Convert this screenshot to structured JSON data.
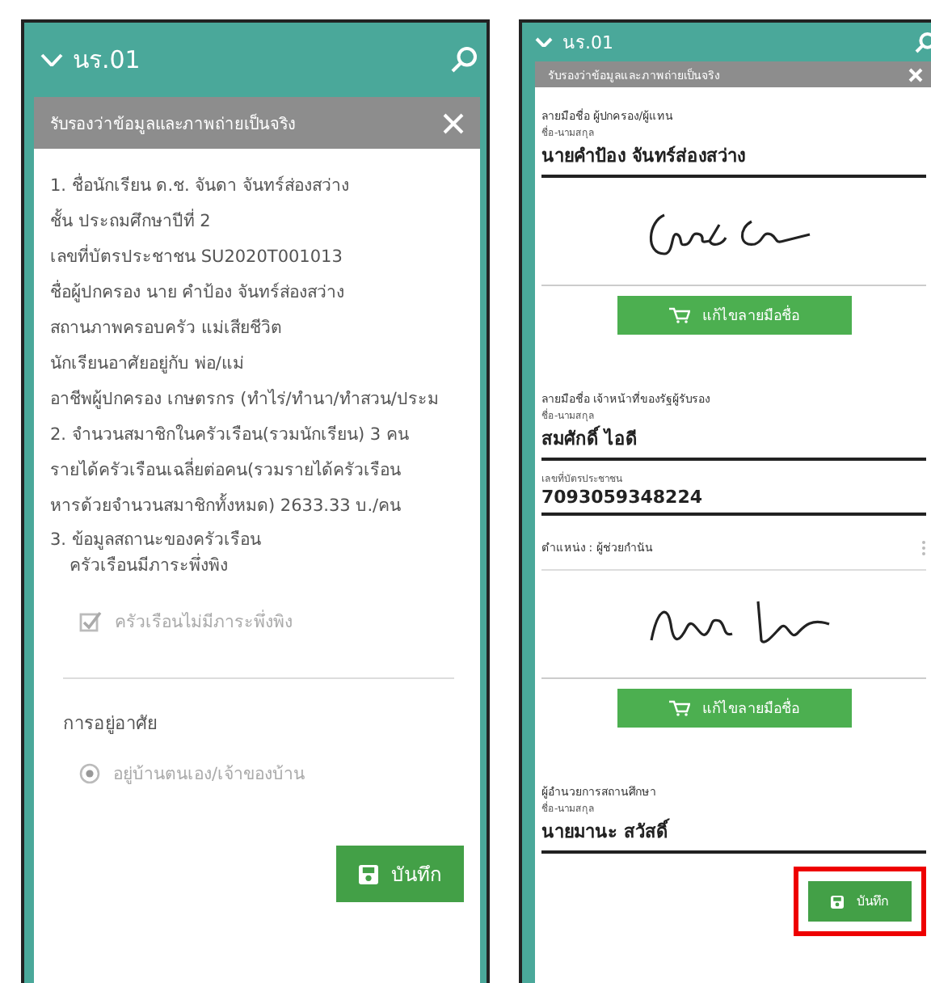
{
  "left_screen": {
    "header": {
      "title": "นร.01"
    },
    "dialog": {
      "title": "รับรองว่าข้อมูลและภาพถ่ายเป็นจริง",
      "items": [
        {
          "kind": "text",
          "text": "1. ชื่อนักเรียน  ด.ช. จันดา จันทร์ส่องสว่าง"
        },
        {
          "kind": "text",
          "text": "ชั้น  ประถมศึกษาปีที่ 2"
        },
        {
          "kind": "text",
          "text": "เลขที่บัตรประชาชน  SU2020T001013"
        },
        {
          "kind": "text",
          "text": "ชื่อผู้ปกครอง  นาย คำป้อง จันทร์ส่องสว่าง"
        },
        {
          "kind": "text",
          "text": "สถานภาพครอบครัว  แม่เสียชีวิต"
        },
        {
          "kind": "text",
          "text": "นักเรียนอาศัยอยู่กับ  พ่อ/แม่"
        },
        {
          "kind": "text",
          "text": "อาชีพผู้ปกครอง  เกษตรกร (ทำไร่/ทำนา/ทำสวน/ประม"
        },
        {
          "kind": "text",
          "text": "2. จำนวนสมาชิกในครัวเรือน(รวมนักเรียน)  3 คน"
        },
        {
          "kind": "text",
          "text": "รายได้ครัวเรือนเฉลี่ยต่อคน(รวมรายได้ครัวเรือน"
        },
        {
          "kind": "text",
          "text": "หารด้วยจำนวนสมาชิกทั้งหมด)  2633.33 บ./คน"
        },
        {
          "kind": "compact",
          "text": "3. ข้อมูลสถานะของครัวเรือน"
        },
        {
          "kind": "indented",
          "text": "ครัวเรือนมีภาระพึ่งพิง"
        },
        {
          "kind": "checkbox",
          "label": "ครัวเรือนไม่มีภาระพึ่งพิง",
          "checked": true
        },
        {
          "kind": "divider"
        },
        {
          "kind": "heading",
          "text": "การอยู่อาศัย"
        },
        {
          "kind": "radio",
          "label": "อยู่บ้านตนเอง/เจ้าของบ้าน",
          "selected": true
        }
      ],
      "save_button": {
        "label": "บันทึก"
      }
    }
  },
  "right_screen": {
    "header": {
      "title": "นร.01"
    },
    "dialog": {
      "title": "รับรองว่าข้อมูลและภาพถ่ายเป็นจริง",
      "signers": [
        {
          "label": "ลายมือชื่อ ผู้ปกครอง/ผู้แทน",
          "name_label": "ชื่อ-นามสกุล",
          "name": "นายคำป้อง จันทร์ส่องสว่าง",
          "signed": true,
          "edit_button": "แก้ไขลายมือชื่อ"
        },
        {
          "label": "ลายมือชื่อ เจ้าหน้าที่ของรัฐผู้รับรอง",
          "name_label": "ชื่อ-นามสกุล",
          "name": "สมศักดิ์ ไอดี",
          "id_label": "เลขที่บัตรประชาชน",
          "id": "7093059348224",
          "position": "ตำแหน่ง : ผู้ช่วยกำนัน",
          "signed": true,
          "edit_button": "แก้ไขลายมือชื่อ"
        },
        {
          "label": "ผู้อำนวยการสถานศึกษา",
          "name_label": "ชื่อ-นามสกุล",
          "name": "นายมานะ สวัสดิ์",
          "signed": false
        }
      ],
      "save_button": {
        "label": "บันทึก",
        "highlighted": true
      }
    }
  }
}
